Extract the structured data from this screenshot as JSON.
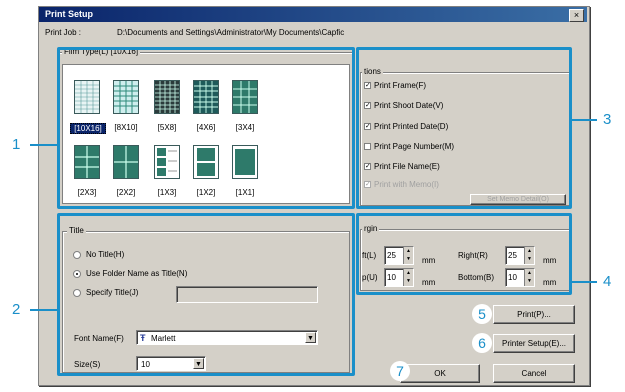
{
  "dialog": {
    "title": "Print Setup",
    "close_glyph": "×",
    "print_job_label": "Print Job :",
    "print_job_path": "D:\\Documents and Settings\\Administrator\\My Documents\\Capfic"
  },
  "film_type": {
    "label": "Film Type(L) [10X16]",
    "layouts": [
      {
        "label": "[10X16]",
        "selected": true
      },
      {
        "label": "[8X10]",
        "selected": false
      },
      {
        "label": "[5X8]",
        "selected": false
      },
      {
        "label": "[4X6]",
        "selected": false
      },
      {
        "label": "[3X4]",
        "selected": false
      },
      {
        "label": "[2X3]",
        "selected": false
      },
      {
        "label": "[2X2]",
        "selected": false
      },
      {
        "label": "[1X3]",
        "selected": false
      },
      {
        "label": "[1X2]",
        "selected": false
      },
      {
        "label": "[1X1]",
        "selected": false
      }
    ]
  },
  "options": {
    "label": "tions",
    "items": [
      {
        "label": "Print Frame(F)",
        "checked": true
      },
      {
        "label": "Print Shoot Date(V)",
        "checked": true
      },
      {
        "label": "Print Printed Date(D)",
        "checked": true
      },
      {
        "label": "Print Page Number(M)",
        "checked": false
      },
      {
        "label": "Print File Name(E)",
        "checked": true
      },
      {
        "label": "Print with Memo(I)",
        "checked": true,
        "disabled": true
      }
    ],
    "memo_button": "Set Memo Detail(O)"
  },
  "title_group": {
    "label": "Title",
    "radios": [
      {
        "label": "No Title(H)",
        "checked": false
      },
      {
        "label": "Use Folder Name as Title(N)",
        "checked": true
      },
      {
        "label": "Specify Title(J)",
        "checked": false
      }
    ],
    "font_label": "Font Name(F)",
    "font_value": "Marlett",
    "font_icon": "Ŧ",
    "size_label": "Size(S)",
    "size_value": "10"
  },
  "margin": {
    "label": "rgin",
    "left_label": "ft(L)",
    "left_value": "25",
    "top_label": "p(U)",
    "top_value": "10",
    "right_label": "Right(R)",
    "right_value": "25",
    "bottom_label": "Bottom(B)",
    "bottom_value": "10",
    "unit": "mm"
  },
  "buttons": {
    "print": "Print(P)...",
    "printer_setup": "Printer Setup(E)...",
    "ok": "OK",
    "cancel": "Cancel"
  },
  "callouts": {
    "c1": "1",
    "c2": "2",
    "c3": "3",
    "c4": "4",
    "c5": "5",
    "c6": "6",
    "c7": "7"
  },
  "colors": {
    "callout_blue": "#1a8fc9",
    "titlebar": "#0a246a",
    "dialog_face": "#d4d0c8",
    "thumb_teal": "#2e8a7a"
  }
}
